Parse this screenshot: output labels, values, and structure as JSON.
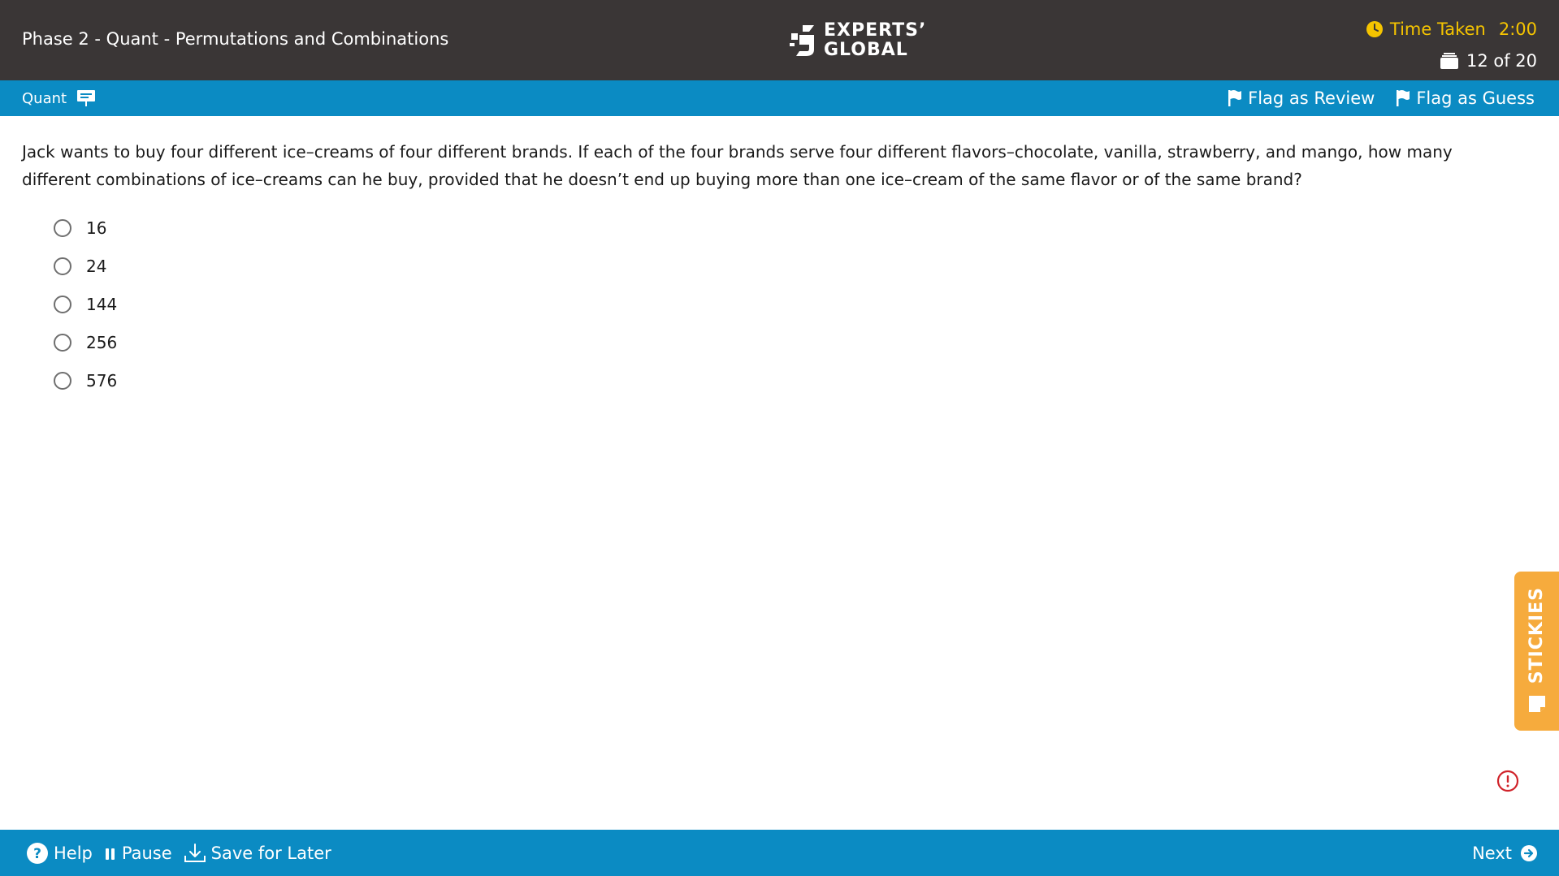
{
  "header": {
    "test_title": "Phase 2 - Quant - Permutations and Combinations",
    "logo_line1": "EXPERTS’",
    "logo_line2": "GLOBAL",
    "time_label": "Time Taken",
    "time_value": "2:00",
    "question_counter": "12 of 20"
  },
  "subbar": {
    "section_label": "Quant",
    "flag_review_label": "Flag as Review",
    "flag_guess_label": "Flag as Guess"
  },
  "question": {
    "text": "Jack wants to buy four different ice–creams of four different brands. If each of the four brands serve four different flavors–chocolate, vanilla, strawberry, and mango, how many different combinations of ice–creams can he buy, provided that he doesn’t end up buying more than one ice–cream of the same flavor or of the same brand?",
    "options": [
      "16",
      "24",
      "144",
      "256",
      "576"
    ]
  },
  "stickies": {
    "label": "STICKIES"
  },
  "footer": {
    "help_label": "Help",
    "pause_label": "Pause",
    "save_label": "Save for Later",
    "next_label": "Next"
  },
  "colors": {
    "header_bg": "#3a3636",
    "bar_blue": "#0b8bc3",
    "timer_yellow": "#f5c400",
    "stickies_orange": "#f6ab3d",
    "alert_red": "#d0232a"
  },
  "icons": {
    "timer": "clock-icon",
    "counter": "stack-icon",
    "section": "whiteboard-icon",
    "flag": "flag-icon",
    "help": "question-circle-icon",
    "pause": "pause-icon",
    "save": "download-icon",
    "next": "arrow-circle-right-icon",
    "alert": "exclamation-circle-icon",
    "stickies": "sticky-note-icon"
  }
}
